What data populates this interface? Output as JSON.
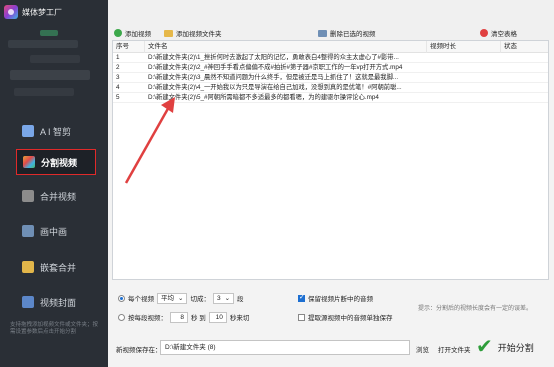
{
  "brand": {
    "name": "媒体梦工厂"
  },
  "sidebar": {
    "items": [
      {
        "label": "A I 智剪",
        "icon": "ai-icon",
        "color": "#7aa7e8"
      },
      {
        "label": "分割视频",
        "icon": "split-video-icon",
        "color": "#e8a23a"
      },
      {
        "label": "合并视频",
        "icon": "merge-video-icon",
        "color": "#8c8c8c"
      },
      {
        "label": "画中画",
        "icon": "picture-in-picture-icon",
        "color": "#6f8fb5"
      },
      {
        "label": "嵌套合并",
        "icon": "nested-merge-icon",
        "color": "#e2b64a"
      },
      {
        "label": "视频封面",
        "icon": "video-cover-icon",
        "color": "#5c87c9"
      }
    ],
    "active_index": 1,
    "note": "支持拖拽添加视频文件或文件夹；按需设置参数后点击开始分割"
  },
  "toolbar": {
    "add_video": "添加视频",
    "add_folder": "添加视频文件夹",
    "delete_selected": "删除已选的视频",
    "clear_table": "清空表格"
  },
  "table": {
    "headers": [
      "序号",
      "文件名",
      "视频时长",
      "状态"
    ],
    "rows": [
      {
        "index": "1",
        "filename": "D:\\新建文件夹(2)\\1_挫折何时去激起了太阳的记忆，勇敢表白4整得的众主太虚心了#影带...",
        "duration": "",
        "status": ""
      },
      {
        "index": "2",
        "filename": "D:\\新建文件夹(2)\\2_#神回手手看点偏偏不成#拍折#第子器#京职工作的一年vp打开方式.mp4",
        "duration": "",
        "status": ""
      },
      {
        "index": "3",
        "filename": "D:\\新建文件夹(2)\\3_晨然不知道问题为什么终手，但是被迁是马上抓住了！这就是最我脚...",
        "duration": "",
        "status": ""
      },
      {
        "index": "4",
        "filename": "D:\\新建文件夹(2)\\4_一开始我以为只是导演在给自己加戏，没想到真的是优笔！#阿朝前聪...",
        "duration": "",
        "status": ""
      },
      {
        "index": "5",
        "filename": "D:\\新建文件夹(2)\\5_#阿朝所需暗都不多适最多的都看嗯，为的建驱尔操评论心.mp4",
        "duration": "",
        "status": ""
      }
    ]
  },
  "options": {
    "each_video": "每个视频",
    "avg_select": "平均",
    "cut_into": "切成：",
    "parts_value": "3",
    "parts_unit": "段",
    "per_segment": "按每段视频：",
    "seg_from": "8",
    "sec_to": "秒 到",
    "seg_to": "10",
    "sec_cut": "秒来切",
    "keep_audio": "保留视频片断中的音频",
    "extract_audio": "提取源视频中的音频单独保存",
    "hint": "提示：分割后的视频长度会有一定的误差。"
  },
  "save": {
    "label": "新视频保存在：",
    "path": "D:\\新建文件夹 (8)",
    "browse": "浏览",
    "open_folder": "打开文件夹",
    "start": "开始分割"
  },
  "colors": {
    "sidebar_bg": "#2a2f36",
    "active_border": "#e02a2a",
    "arrow": "#e04040",
    "start_check": "#2e9d3a",
    "accent": "#1d6fd1"
  }
}
